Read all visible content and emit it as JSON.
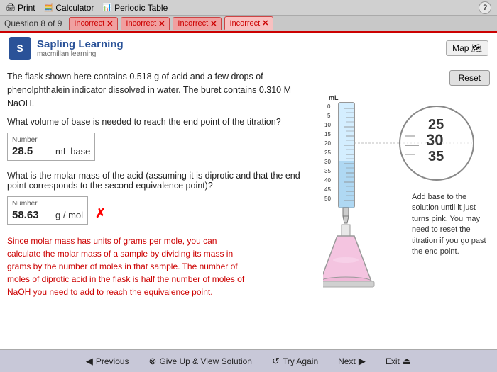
{
  "topBar": {
    "print": "Print",
    "calculator": "Calculator",
    "periodicTable": "Periodic Table",
    "help": "?"
  },
  "tabBar": {
    "questionLabel": "Question 8 of 9",
    "tabs": [
      {
        "label": "Incorrect",
        "active": false
      },
      {
        "label": "Incorrect",
        "active": false
      },
      {
        "label": "Incorrect",
        "active": false
      },
      {
        "label": "Incorrect",
        "active": true
      }
    ]
  },
  "header": {
    "logoLetter": "S",
    "logoText": "Sapling Learning",
    "logoSub": "macmillan learning",
    "mapBtn": "Map"
  },
  "problem": {
    "description": "The flask shown here contains 0.518 g of acid and a few drops of phenolphthalein indicator dissolved in water. The buret contains 0.310 M NaOH.",
    "q1": "What volume of base is needed to reach the end point of the titration?",
    "q1_box_label": "Number",
    "q1_value": "28.5",
    "q1_unit": "mL  base",
    "q2": "What is the molar mass of the acid (assuming it is diprotic and that the end point corresponds to the second equivalence point)?",
    "q2_box_label": "Number",
    "q2_value": "58.63",
    "q2_unit": "g / mol",
    "explanation": "Since molar mass has units of grams per mole, you can calculate the molar mass of a sample by dividing its mass in grams by the number of moles in that sample. The number of moles of diprotic acid in the flask is half the number of moles of NaOH you need to add to reach the equivalence point."
  },
  "apparatus": {
    "resetBtn": "Reset",
    "mlLabel": "mL",
    "scaleValues": [
      "0",
      "5",
      "10",
      "15",
      "20",
      "25",
      "30",
      "35",
      "40",
      "45",
      "50"
    ],
    "circleValues": [
      "25",
      "30",
      "35"
    ],
    "note": "Add base to the solution until it just turns pink. You may need to reset the titration if you go past the end point."
  },
  "footer": {
    "previous": "Previous",
    "giveUp": "Give Up & View Solution",
    "tryAgain": "Try Again",
    "next": "Next",
    "exit": "Exit"
  }
}
